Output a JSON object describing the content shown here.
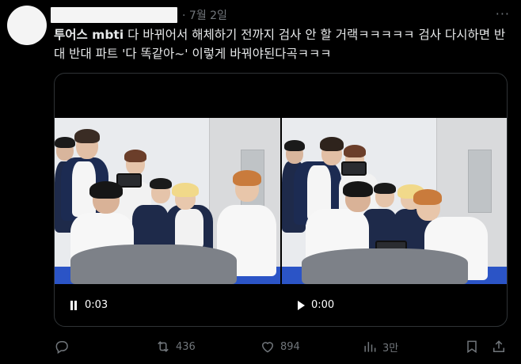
{
  "post": {
    "date_separator": "·",
    "date": "7월 2일",
    "more_label": "···",
    "text_bold": "투어스 mbti",
    "text_body": " 다 바뀌어서 해체하기 전까지 검사 안 할 거랙ㅋㅋㅋㅋㅋ 검사 다시하면 반대 반대 파트 '다 똑같아~' 이렇게 바꿔야된다곡ㅋㅋㅋ"
  },
  "videos": [
    {
      "state": "playing",
      "time": "0:03"
    },
    {
      "state": "paused",
      "time": "0:00"
    }
  ],
  "actions": {
    "reply_count": "",
    "retweet_count": "436",
    "like_count": "894",
    "views_count": "3만"
  },
  "colors": {
    "background": "#000000",
    "text": "#e7e9ea",
    "muted": "#71767b",
    "border": "#2f3336"
  },
  "icons": [
    "reply-icon",
    "retweet-icon",
    "like-icon",
    "views-icon",
    "bookmark-icon",
    "share-icon",
    "pause-icon",
    "play-icon",
    "more-icon"
  ]
}
